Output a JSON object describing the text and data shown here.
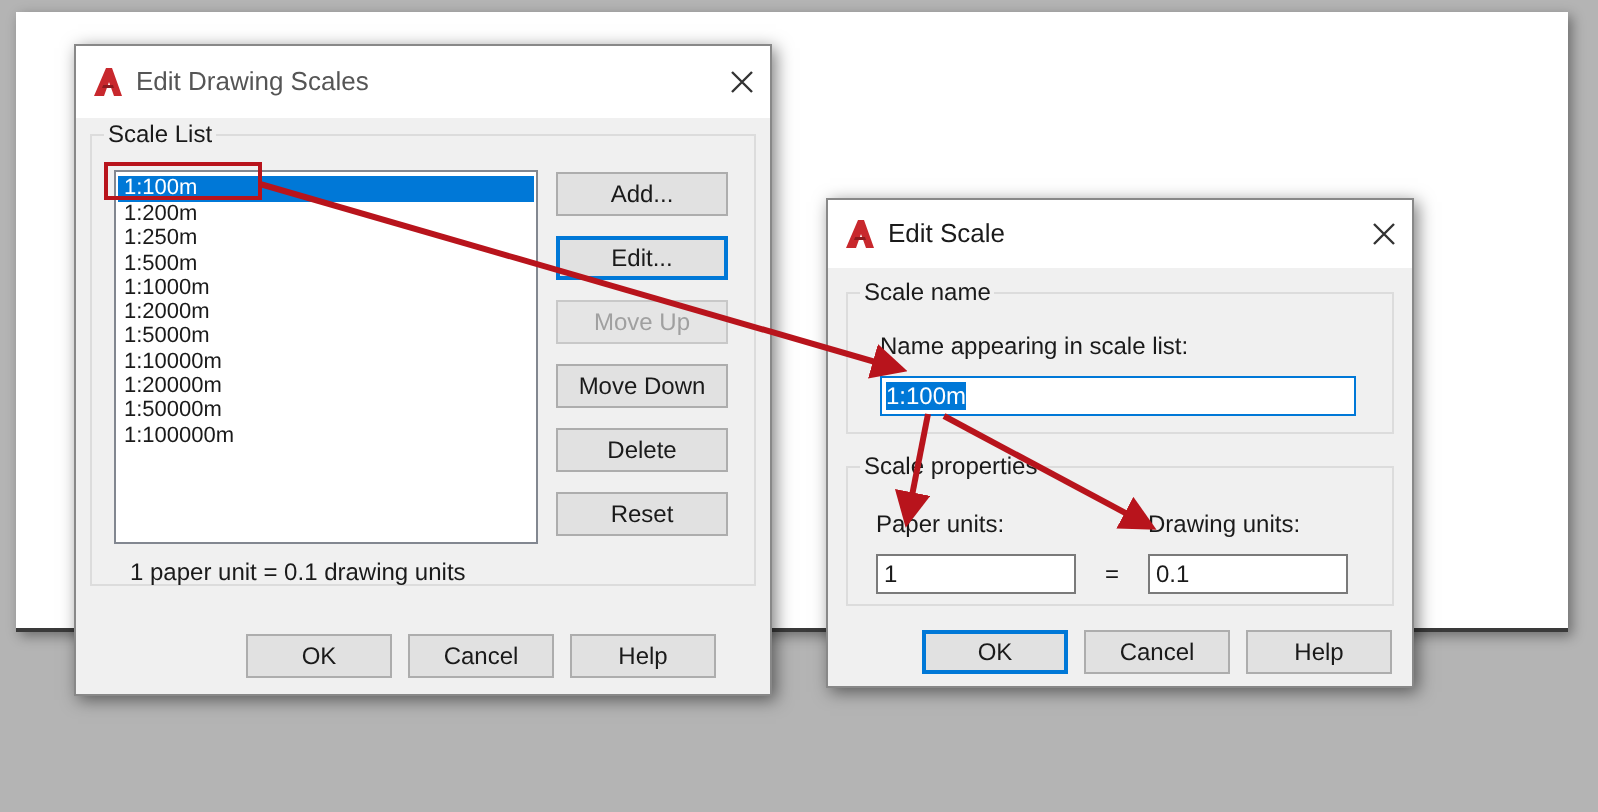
{
  "scales_dialog": {
    "title": "Edit Drawing Scales",
    "group_label": "Scale List",
    "scales": [
      {
        "label": "1:100m",
        "selected": true
      },
      {
        "label": "1:200m",
        "selected": false
      },
      {
        "label": "1:250m",
        "selected": false
      },
      {
        "label": "1:500m",
        "selected": false
      },
      {
        "label": "1:1000m",
        "selected": false
      },
      {
        "label": "1:2000m",
        "selected": false
      },
      {
        "label": "1:5000m",
        "selected": false
      },
      {
        "label": "1:10000m",
        "selected": false
      },
      {
        "label": "1:20000m",
        "selected": false
      },
      {
        "label": "1:50000m",
        "selected": false
      },
      {
        "label": "1:100000m",
        "selected": false
      }
    ],
    "side_buttons": [
      {
        "label": "Add...",
        "focused": false,
        "disabled": false
      },
      {
        "label": "Edit...",
        "focused": true,
        "disabled": false
      },
      {
        "label": "Move Up",
        "focused": false,
        "disabled": true
      },
      {
        "label": "Move Down",
        "focused": false,
        "disabled": false
      },
      {
        "label": "Delete",
        "focused": false,
        "disabled": false
      },
      {
        "label": "Reset",
        "focused": false,
        "disabled": false
      }
    ],
    "info": "1 paper unit = 0.1 drawing units",
    "buttons": [
      {
        "label": "OK",
        "focused": false
      },
      {
        "label": "Cancel",
        "focused": false
      },
      {
        "label": "Help",
        "focused": false
      }
    ]
  },
  "scale_dialog": {
    "title": "Edit Scale",
    "name_group": "Scale name",
    "name_label": "Name appearing in scale list:",
    "name_value": "1:100m",
    "properties_group": "Scale properties",
    "paper_label": "Paper units:",
    "paper_value": "1",
    "equals": "=",
    "drawing_label": "Drawing units:",
    "drawing_value": "0.1",
    "buttons": [
      {
        "label": "OK",
        "focused": true
      },
      {
        "label": "Cancel",
        "focused": false
      },
      {
        "label": "Help",
        "focused": false
      }
    ]
  }
}
